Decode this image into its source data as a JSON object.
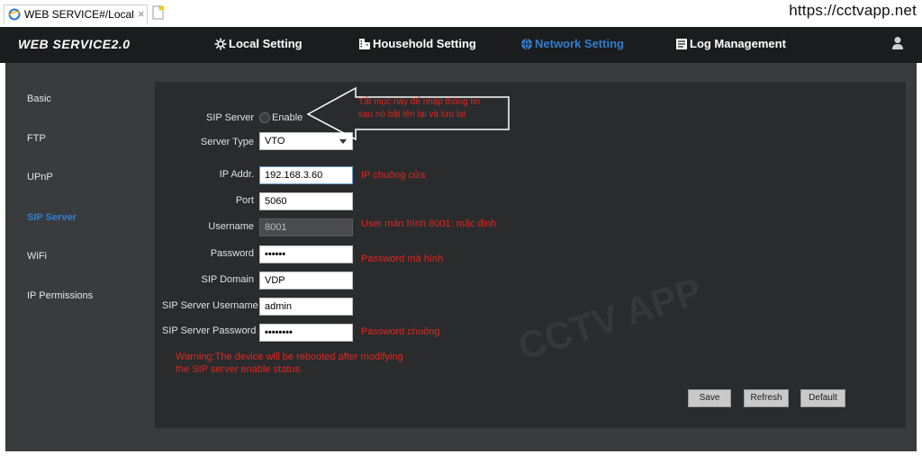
{
  "browser": {
    "tab_title": "WEB SERVICE#/Local",
    "tab_close": "×",
    "source_watermark": "https://cctvapp.net"
  },
  "app": {
    "logo": "WEB SERVICE2.0",
    "nav": [
      {
        "label": "Local Setting",
        "icon": "gear-icon",
        "active": false
      },
      {
        "label": "Household Setting",
        "icon": "building-icon",
        "active": false
      },
      {
        "label": "Network Setting",
        "icon": "globe-icon",
        "active": true
      },
      {
        "label": "Log Management",
        "icon": "log-icon",
        "active": false
      }
    ],
    "accent_color": "#2f7fd1"
  },
  "sidebar": {
    "items": [
      {
        "label": "Basic",
        "active": false
      },
      {
        "label": "FTP",
        "active": false
      },
      {
        "label": "UPnP",
        "active": false
      },
      {
        "label": "SIP Server",
        "active": true
      },
      {
        "label": "WiFi",
        "active": false
      },
      {
        "label": "IP Permissions",
        "active": false
      }
    ]
  },
  "form": {
    "sip_server": {
      "label": "SIP Server",
      "option": "Enable",
      "checked": false
    },
    "server_type": {
      "label": "Server Type",
      "value": "VTO"
    },
    "ip_addr": {
      "label": "IP Addr.",
      "value": "192.168.3.60"
    },
    "port": {
      "label": "Port",
      "value": "5060"
    },
    "username": {
      "label": "Username",
      "value": "8001"
    },
    "password": {
      "label": "Password",
      "value": "••••••"
    },
    "sip_domain": {
      "label": "SIP Domain",
      "value": "VDP"
    },
    "sip_server_username": {
      "label": "SIP Server Username",
      "value": "admin"
    },
    "sip_server_password": {
      "label": "SIP Server Password",
      "value": "••••••••"
    },
    "warning": "Warning:The device will be rebooted after modifying the SIP server enable status."
  },
  "annotations": {
    "arrow_note_line1": "Tắt mục này để nhập thông tin",
    "arrow_note_line2": "sau nó bật lên lại và lưu lại",
    "ip_note": "IP chuông cửa",
    "username_note": "User màn hình 8001: mặc định",
    "password_note": "Password mà hình",
    "sip_password_note": "Password chuông",
    "annotation_color": "#e0281e"
  },
  "buttons": {
    "save": "Save",
    "refresh": "Refresh",
    "default": "Default"
  },
  "watermark": "CCTV APP"
}
